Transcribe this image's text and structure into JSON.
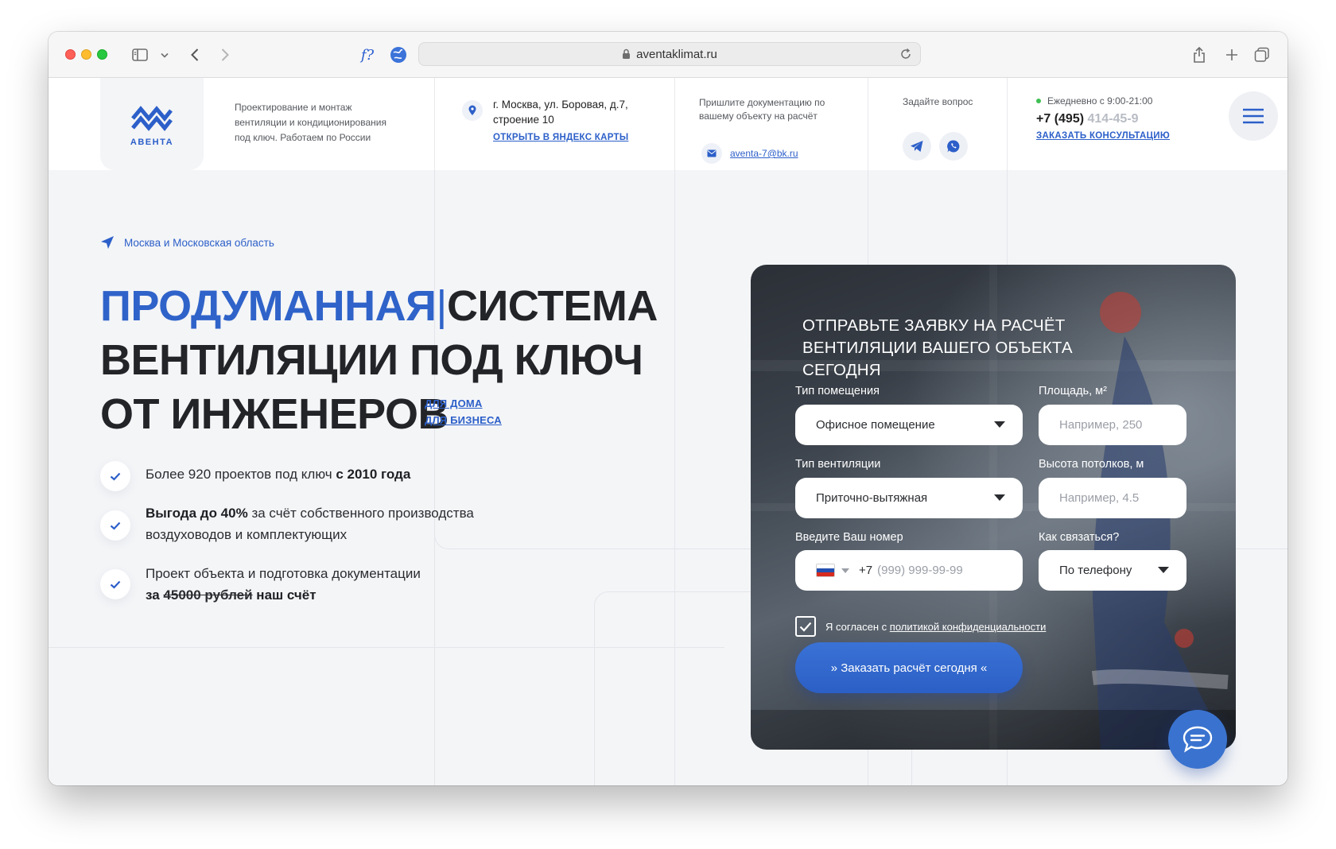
{
  "browser": {
    "url": "aventaklimat.ru",
    "extension_label": "f?"
  },
  "header": {
    "logo_text": "АВЕНТА",
    "tagline": "Проектирование и монтаж вентиляции и кондиционирования под ключ. Работаем по России",
    "address": "г. Москва, ул. Боровая, д.7, строение 10",
    "map_link": "ОТКРЫТЬ В ЯНДЕКС КАРТЫ",
    "docs_text": "Пришлите документацию по вашему объекту на расчёт",
    "email": "aventa-7@bk.ru",
    "ask_text": "Задайте вопрос",
    "hours": "Ежедневно с 9:00-21:00",
    "phone_visible": "+7 (495)",
    "phone_faded": "414-45-9",
    "consult_link": "ЗАКАЗАТЬ КОНСУЛЬТАЦИЮ"
  },
  "hero": {
    "region": "Москва и Московская область",
    "headline_blue": "ПРОДУМАННАЯ",
    "headline_cursor": "|",
    "headline_rest1": "СИСТЕМА",
    "headline_line2": "ВЕНТИЛЯЦИИ ПОД КЛЮЧ",
    "headline_line3": "ОТ ИНЖЕНЕРОВ",
    "link_home": "ДЛЯ ДОМА",
    "link_business": "ДЛЯ БИЗНЕСА"
  },
  "benefits": [
    {
      "text": "Более 920 проектов под ключ ",
      "bold": "с 2010 года"
    },
    {
      "bold": "Выгода до 40%",
      "text": " за счёт собственного производства воздуховодов и комплектующих"
    },
    {
      "text": "Проект объекта и подготовка документации",
      "bold_prefix": "за ",
      "strike": "45000 рублей",
      "bold_suffix": " наш счёт"
    }
  ],
  "form": {
    "title": "ОТПРАВЬТЕ ЗАЯВКУ НА РАСЧЁТ ВЕНТИЛЯЦИИ ВАШЕГО ОБЪЕКТА СЕГОДНЯ",
    "room_type_label": "Тип помещения",
    "room_type_value": "Офисное помещение",
    "area_label": "Площадь, м²",
    "area_placeholder": "Например, 250",
    "vent_type_label": "Тип вентиляции",
    "vent_type_value": "Приточно-вытяжная",
    "height_label": "Высота потолков, м",
    "height_placeholder": "Например, 4.5",
    "phone_label": "Введите Ваш номер",
    "phone_prefix": "+7",
    "phone_placeholder": "(999) 999-99-99",
    "contact_label": "Как связаться?",
    "contact_value": "По телефону",
    "consent_text": "Я согласен с ",
    "consent_link": "политикой конфиденциальности",
    "submit_label": "» Заказать расчёт сегодня «"
  },
  "colors": {
    "accent": "#2f63c9",
    "page_bg": "#f4f5f7",
    "status_online": "#3fbf55"
  }
}
